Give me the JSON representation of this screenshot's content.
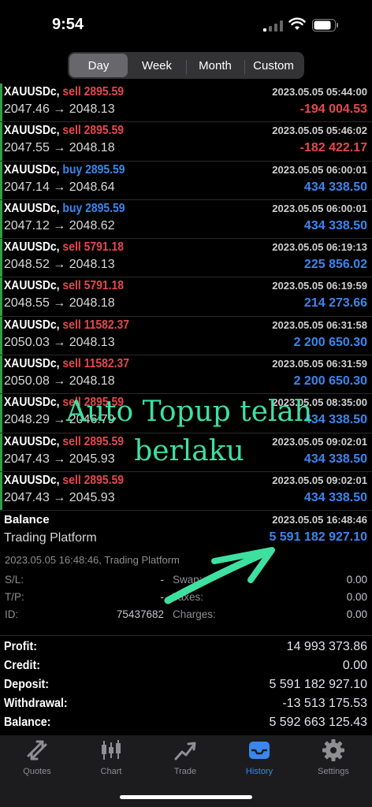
{
  "status": {
    "time": "9:54"
  },
  "period_tabs": [
    {
      "label": "Day",
      "active": true
    },
    {
      "label": "Week",
      "active": false
    },
    {
      "label": "Month",
      "active": false
    },
    {
      "label": "Custom",
      "active": false
    }
  ],
  "deals": [
    {
      "symbol": "XAUUSDc,",
      "side": "sell",
      "volume": "2895.59",
      "open": "2047.46",
      "arrow": "→",
      "close": "2048.13",
      "datetime": "2023.05.05 05:44:00",
      "profit": "-194 004.53",
      "profit_sign": "neg"
    },
    {
      "symbol": "XAUUSDc,",
      "side": "sell",
      "volume": "2895.59",
      "open": "2047.55",
      "arrow": "→",
      "close": "2048.18",
      "datetime": "2023.05.05 05:46:02",
      "profit": "-182 422.17",
      "profit_sign": "neg"
    },
    {
      "symbol": "XAUUSDc,",
      "side": "buy",
      "volume": "2895.59",
      "open": "2047.14",
      "arrow": "→",
      "close": "2048.64",
      "datetime": "2023.05.05 06:00:01",
      "profit": "434 338.50",
      "profit_sign": "pos"
    },
    {
      "symbol": "XAUUSDc,",
      "side": "buy",
      "volume": "2895.59",
      "open": "2047.12",
      "arrow": "→",
      "close": "2048.62",
      "datetime": "2023.05.05 06:00:01",
      "profit": "434 338.50",
      "profit_sign": "pos"
    },
    {
      "symbol": "XAUUSDc,",
      "side": "sell",
      "volume": "5791.18",
      "open": "2048.52",
      "arrow": "→",
      "close": "2048.13",
      "datetime": "2023.05.05 06:19:13",
      "profit": "225 856.02",
      "profit_sign": "pos"
    },
    {
      "symbol": "XAUUSDc,",
      "side": "sell",
      "volume": "5791.18",
      "open": "2048.55",
      "arrow": "→",
      "close": "2048.18",
      "datetime": "2023.05.05 06:19:59",
      "profit": "214 273.66",
      "profit_sign": "pos"
    },
    {
      "symbol": "XAUUSDc,",
      "side": "sell",
      "volume": "11582.37",
      "open": "2050.03",
      "arrow": "→",
      "close": "2048.13",
      "datetime": "2023.05.05 06:31:58",
      "profit": "2 200 650.30",
      "profit_sign": "pos"
    },
    {
      "symbol": "XAUUSDc,",
      "side": "sell",
      "volume": "11582.37",
      "open": "2050.08",
      "arrow": "→",
      "close": "2048.18",
      "datetime": "2023.05.05 06:31:59",
      "profit": "2 200 650.30",
      "profit_sign": "pos"
    },
    {
      "symbol": "XAUUSDc,",
      "side": "sell",
      "volume": "2895.59",
      "open": "2048.29",
      "arrow": "→",
      "close": "2046.79",
      "datetime": "2023.05.05 08:35:00",
      "profit": "434 338.50",
      "profit_sign": "pos"
    },
    {
      "symbol": "XAUUSDc,",
      "side": "sell",
      "volume": "2895.59",
      "open": "2047.43",
      "arrow": "→",
      "close": "2045.93",
      "datetime": "2023.05.05 09:02:01",
      "profit": "434 338.50",
      "profit_sign": "pos"
    },
    {
      "symbol": "XAUUSDc,",
      "side": "sell",
      "volume": "2895.59",
      "open": "2047.43",
      "arrow": "→",
      "close": "2045.93",
      "datetime": "2023.05.05 09:02:01",
      "profit": "434 338.50",
      "profit_sign": "pos"
    }
  ],
  "balance_entry": {
    "label": "Balance",
    "sublabel": "Trading Platform",
    "datetime": "2023.05.05 16:48:46",
    "amount": "5 591 182 927.10"
  },
  "detail": {
    "header": "2023.05.05 16:48:46, Trading Platform",
    "sl_label": "S/L:",
    "sl_value": "-",
    "tp_label": "T/P:",
    "tp_value": "-",
    "id_label": "ID:",
    "id_value": "75437682",
    "swap_label": "Swap:",
    "swap_value": "0.00",
    "taxes_label": "Taxes:",
    "taxes_value": "0.00",
    "charges_label": "Charges:",
    "charges_value": "0.00"
  },
  "summary": [
    {
      "label": "Profit:",
      "value": "14 993 373.86"
    },
    {
      "label": "Credit:",
      "value": "0.00"
    },
    {
      "label": "Deposit:",
      "value": "5 591 182 927.10"
    },
    {
      "label": "Withdrawal:",
      "value": "-13 513 175.53"
    },
    {
      "label": "Balance:",
      "value": "5 592 663 125.43"
    }
  ],
  "tabbar": [
    {
      "label": "Quotes",
      "icon": "quotes-icon",
      "active": false
    },
    {
      "label": "Chart",
      "icon": "chart-icon",
      "active": false
    },
    {
      "label": "Trade",
      "icon": "trade-icon",
      "active": false
    },
    {
      "label": "History",
      "icon": "history-icon",
      "active": true
    },
    {
      "label": "Settings",
      "icon": "gear-icon",
      "active": false
    }
  ],
  "overlay": {
    "line1": "Auto Topup telah",
    "line2": "berlaku",
    "color": "#3ee0a0"
  },
  "colors": {
    "sell": "#e5484d",
    "buy": "#3a86f0",
    "positive": "#3a86f0",
    "negative": "#e5484d",
    "deal_bar": "#2ea043"
  }
}
